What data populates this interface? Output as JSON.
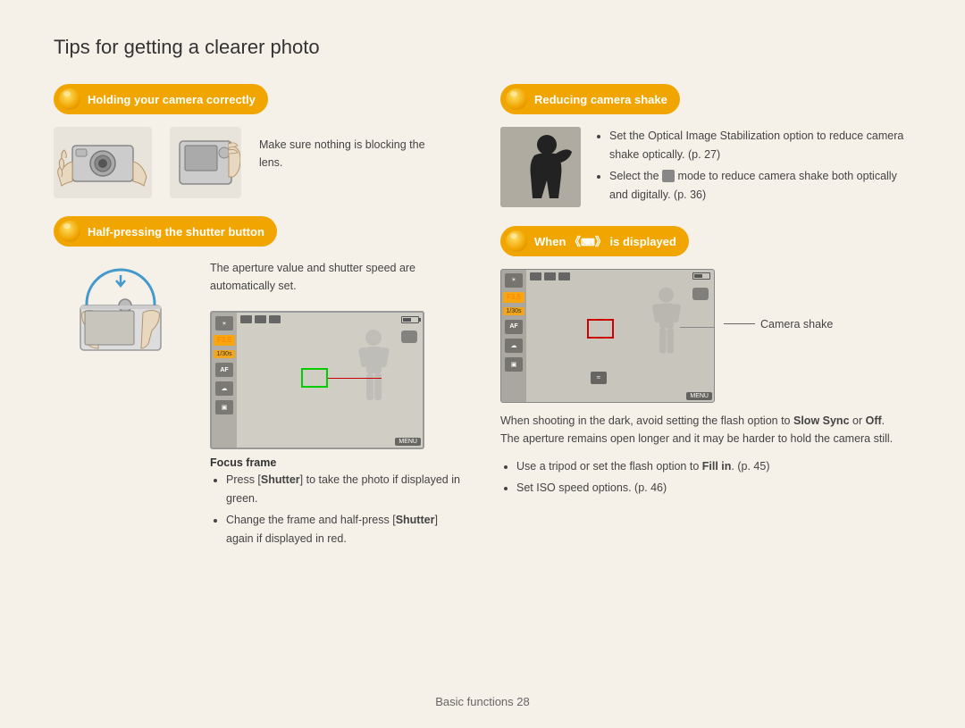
{
  "page": {
    "title": "Tips for getting a clearer photo",
    "footer": "Basic functions  28"
  },
  "sections": {
    "holding": {
      "label": "Holding your camera correctly",
      "text": "Make sure nothing is blocking the lens."
    },
    "half_press": {
      "label": "Half-pressing the shutter button",
      "aperture_text": "The aperture value and shutter speed are automatically set.",
      "focus_frame_label": "Focus frame",
      "focus_bullets": [
        "Press [Shutter] to take the photo if displayed in green.",
        "Change the frame and half-press [Shutter] again if displayed in red."
      ]
    },
    "reducing": {
      "label": "Reducing camera shake",
      "bullets": [
        "Set the Optical Image Stabilization option to reduce camera shake optically. (p. 27)",
        "Select the  mode to reduce camera shake both optically and digitally. (p. 36)"
      ]
    },
    "when": {
      "label": "When «» is displayed",
      "camera_shake_label": "Camera shake",
      "intro": "When shooting in the dark, avoid setting the flash option to Slow Sync or Off. The aperture remains open longer and it may be harder to hold the camera still.",
      "bullets": [
        "Use a tripod or set the flash option to Fill in. (p. 45)",
        "Set ISO speed options. (p. 46)"
      ]
    }
  },
  "screen": {
    "aperture": "F3.5",
    "shutter_speed": "1/30s",
    "menu_label": "MENU"
  }
}
